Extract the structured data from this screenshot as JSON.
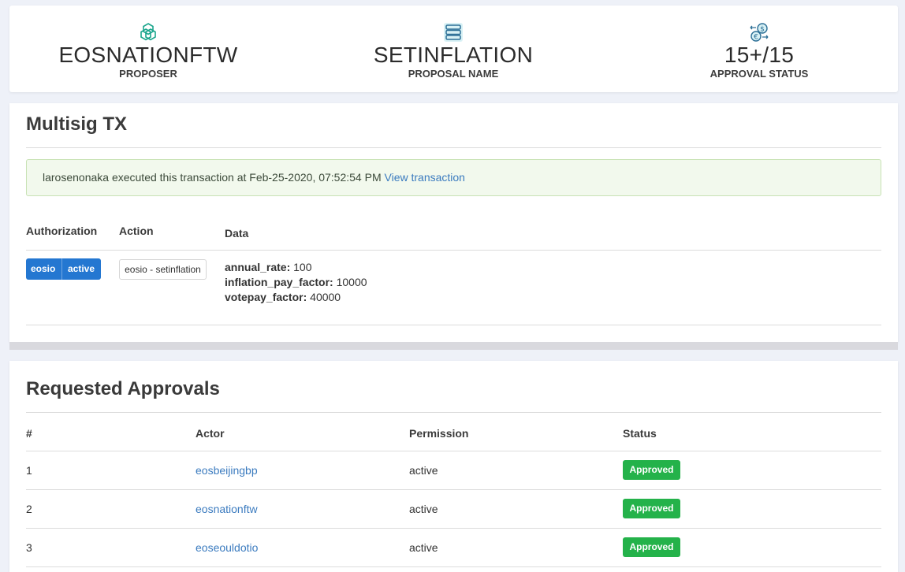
{
  "header": {
    "proposer": {
      "value": "EOSNATIONFTW",
      "label": "PROPOSER",
      "icon": "hexagon-cubes-icon"
    },
    "proposal": {
      "value": "SETINFLATION",
      "label": "PROPOSAL NAME",
      "icon": "server-icon"
    },
    "approval": {
      "value": "15+/15",
      "label": "APPROVAL STATUS",
      "icon": "currency-exchange-icon"
    }
  },
  "tx": {
    "title": "Multisig TX",
    "alert_text": "larosenonaka executed this transaction at Feb-25-2020, 07:52:54 PM ",
    "alert_link": "View transaction",
    "headers": {
      "authorization": "Authorization",
      "action": "Action",
      "data": "Data"
    },
    "auth": {
      "actor": "eosio",
      "permission": "active"
    },
    "action": "eosio - setinflation",
    "data": [
      {
        "key": "annual_rate:",
        "value": " 100"
      },
      {
        "key": "inflation_pay_factor:",
        "value": " 10000"
      },
      {
        "key": "votepay_factor:",
        "value": " 40000"
      }
    ]
  },
  "approvals": {
    "title": "Requested Approvals",
    "headers": {
      "num": "#",
      "actor": "Actor",
      "permission": "Permission",
      "status": "Status"
    },
    "rows": [
      {
        "num": "1",
        "actor": "eosbeijingbp",
        "permission": "active",
        "status": "Approved"
      },
      {
        "num": "2",
        "actor": "eosnationftw",
        "permission": "active",
        "status": "Approved"
      },
      {
        "num": "3",
        "actor": "eoseouldotio",
        "permission": "active",
        "status": "Approved"
      }
    ]
  },
  "colors": {
    "accent": "#2477d1",
    "link": "#3b7bbf",
    "approved": "#24b24a",
    "alert_bg": "#f2f9ed"
  }
}
